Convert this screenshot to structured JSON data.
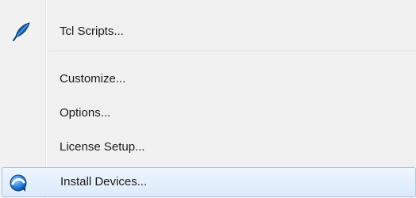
{
  "menu": {
    "items": [
      {
        "label": "Tcl Scripts...",
        "icon": "feather-icon"
      },
      {
        "label": "Customize..."
      },
      {
        "label": "Options..."
      },
      {
        "label": "License Setup..."
      },
      {
        "label": "Install Devices...",
        "icon": "install-devices-icon",
        "highlighted": true
      }
    ]
  },
  "colors": {
    "highlight_border": "#a8c8ef",
    "highlight_fill": "#dbeafb",
    "feather": "#1b5fa8"
  }
}
